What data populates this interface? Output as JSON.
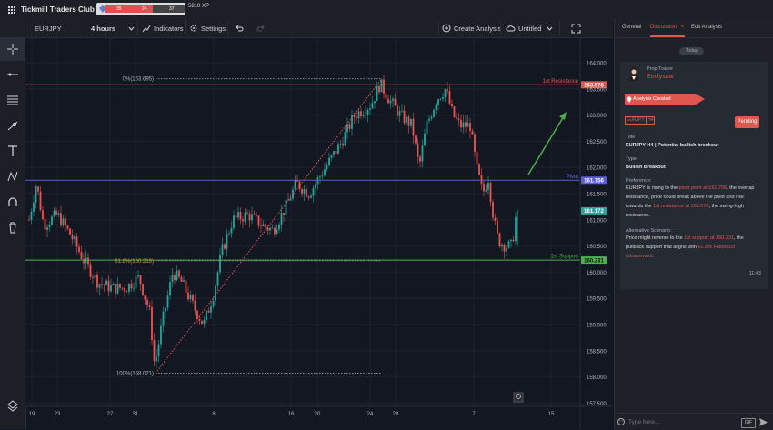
{
  "app": {
    "title": "Tickmill Traders Club",
    "xp": "5810 XP",
    "xp_segments": [
      "35",
      "24",
      "37"
    ],
    "xp_progress": 0.6
  },
  "toolbar": {
    "symbol": "EURJPY",
    "timeframe": "4 hours",
    "indicators": "Indicators",
    "settings": "Settings",
    "create_analysis": "Create Analysis",
    "layout_name": "Untitled"
  },
  "left_tools": [
    "crosshair-icon",
    "horizontal-line-icon",
    "fib-lines-icon",
    "trend-line-icon",
    "text-icon",
    "pattern-icon",
    "magnet-icon",
    "trash-icon",
    "layers-icon"
  ],
  "chart": {
    "y_ticks": [
      "164.000",
      "163.500",
      "163.000",
      "162.500",
      "162.000",
      "161.500",
      "161.000",
      "160.500",
      "160.000",
      "159.500",
      "159.000",
      "158.500",
      "158.000",
      "157.500"
    ],
    "x_ticks": [
      "19",
      "23",
      "27",
      "31",
      "8",
      "16",
      "20",
      "24",
      "28",
      "7",
      "15"
    ],
    "price_labels": {
      "resistance": "163.578",
      "pivot": "161.756",
      "current": "161.172",
      "support": "160.231"
    },
    "line_labels": {
      "resistance": "1st Resistance",
      "pivot": "Pivot",
      "support": "1st Support"
    },
    "fib_labels": {
      "top": "0%(163.695)",
      "mid": "61.8%(160.219)",
      "bottom": "100%(158.071)"
    },
    "colors": {
      "up": "#26a69a",
      "down": "#ef5350",
      "resistance": "#e0574f",
      "pivot": "#5b5bdc",
      "support": "#4caf50"
    }
  },
  "panel": {
    "tabs": [
      "General",
      "Discussion",
      "Edit Analysis"
    ],
    "active_tab": "Discussion",
    "today": "Today",
    "author_role": "Prop Trader",
    "author_name": "Emilysaw",
    "status_ribbon": "Analysis Created",
    "tags": [
      "EURJPY",
      "H4"
    ],
    "pending": "Pending",
    "title_label": "Title",
    "title_value": "EURJPY H4 | Potential bullish breakout",
    "type_label": "Type",
    "type_value": "Bullish Breakout",
    "pref_label": "Preference:",
    "pref_parts": [
      "EURJPY is rising to the ",
      "pivot point at 161.756",
      ", the overlap resistance, price could break above the pivot and rise towards the ",
      "1st resistance at 163.578",
      ", the swing-high resistance."
    ],
    "alt_label": "Alternative Scenario:",
    "alt_parts": [
      "Price might reverse to the ",
      "1st support at 160.231",
      ", the pullback support that aligns with ",
      "61.8% Fibonacci retracement",
      "."
    ],
    "time": "11:43",
    "message_placeholder": "Type here...",
    "gif": "GIF"
  }
}
